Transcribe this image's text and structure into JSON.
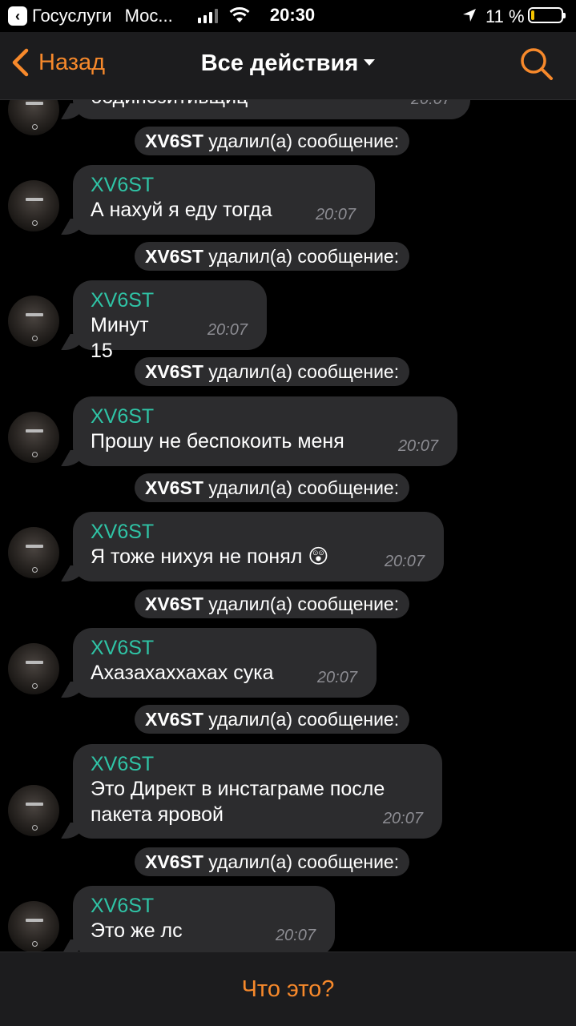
{
  "status_bar": {
    "back_app_label": "Госуслуги",
    "carrier": "Мос...",
    "time": "20:30",
    "battery_percent": "11 %",
    "battery_level": 0.11
  },
  "nav": {
    "back_label": "Назад",
    "title": "Все действия",
    "accent_color": "#f7892b",
    "search_icon": "search-icon"
  },
  "feed": {
    "top_partial": {
      "text": "бодипозитивщиц",
      "time": "20:07"
    },
    "service_message": {
      "actor": "XV6ST",
      "action": "удалил(а) сообщение:"
    },
    "messages": [
      {
        "sender": "XV6ST",
        "lines": [
          "А нахуй я еду тогда"
        ],
        "time": "20:07"
      },
      {
        "sender": "XV6ST",
        "lines": [
          "Минут 15"
        ],
        "time": "20:07"
      },
      {
        "sender": "XV6ST",
        "lines": [
          "Прошу не беспокоить меня"
        ],
        "time": "20:07"
      },
      {
        "sender": "XV6ST",
        "lines": [
          "Я тоже нихуя не понял 😲"
        ],
        "time": "20:07"
      },
      {
        "sender": "XV6ST",
        "lines": [
          "Ахазахаххахах сука"
        ],
        "time": "20:07"
      },
      {
        "sender": "XV6ST",
        "lines": [
          "Это Директ в инстаграме после",
          "пакета яровой"
        ],
        "time": "20:07"
      },
      {
        "sender": "XV6ST",
        "lines": [
          "Это же лс наше"
        ],
        "time": "20:07"
      }
    ]
  },
  "bottom_bar": {
    "action_label": "Что это?"
  }
}
